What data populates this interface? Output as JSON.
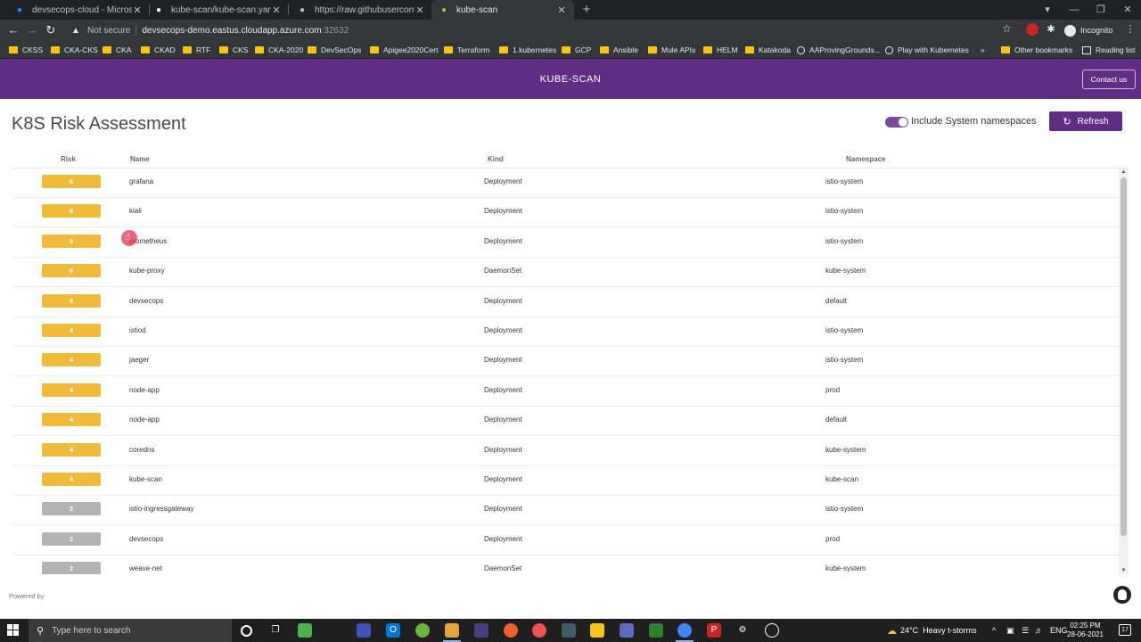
{
  "browser": {
    "tabs": [
      {
        "title": "devsecops-cloud - Microsoft Azu",
        "icon": "azure-icon",
        "color": "#1e90ff",
        "active": false
      },
      {
        "title": "kube-scan/kube-scan.yaml at ma",
        "icon": "github-icon",
        "color": "#ffffff",
        "active": false
      },
      {
        "title": "https://raw.githubusercontent.co",
        "icon": "globe-icon",
        "color": "#bdc1c6",
        "active": false
      },
      {
        "title": "kube-scan",
        "icon": "kube-scan-icon",
        "color": "#8bc34a",
        "active": true
      }
    ],
    "new_tab_glyph": "+",
    "address": {
      "security": "Not secure",
      "host": "devsecops-demo.eastus.cloudapp.azure.com",
      "port": ":32632"
    },
    "profile_label": "Incognito",
    "bookmarks": [
      {
        "label": "CKSS",
        "kind": "folder"
      },
      {
        "label": "CKA-CKS",
        "kind": "folder"
      },
      {
        "label": "CKA",
        "kind": "folder"
      },
      {
        "label": "CKAD",
        "kind": "folder"
      },
      {
        "label": "RTF",
        "kind": "folder"
      },
      {
        "label": "CKS",
        "kind": "folder"
      },
      {
        "label": "CKA-2020",
        "kind": "folder"
      },
      {
        "label": "DevSecOps",
        "kind": "folder"
      },
      {
        "label": "Apigee2020Cert",
        "kind": "folder"
      },
      {
        "label": "Terraform",
        "kind": "folder"
      },
      {
        "label": "1.kubernetes",
        "kind": "folder"
      },
      {
        "label": "GCP",
        "kind": "folder"
      },
      {
        "label": "Ansible",
        "kind": "folder"
      },
      {
        "label": "Mule APIs",
        "kind": "folder"
      },
      {
        "label": "HELM",
        "kind": "folder"
      },
      {
        "label": "Katakoda",
        "kind": "folder"
      },
      {
        "label": "AAProvingGrounds...",
        "kind": "link"
      },
      {
        "label": "Play with Kubernetes",
        "kind": "link"
      }
    ],
    "bookmarks_overflow": "»",
    "other_bookmarks": "Other bookmarks",
    "reading_list": "Reading list"
  },
  "app": {
    "title": "KUBE-SCAN",
    "contact_label": "Contact us",
    "page_title": "K8S Risk Assessment",
    "include_system_label": "Include System namespaces",
    "include_system_on": true,
    "refresh_label": "Refresh",
    "colors": {
      "brand": "#5f2e84",
      "risk_high": "#f0bb3a",
      "risk_low": "#b3b3b3"
    },
    "columns": {
      "risk": "Risk",
      "name": "Name",
      "kind": "Kind",
      "namespace": "Namespace"
    },
    "rows": [
      {
        "risk": "6",
        "level": "high",
        "name": "grafana",
        "kind": "Deployment",
        "namespace": "istio-system"
      },
      {
        "risk": "6",
        "level": "high",
        "name": "kiali",
        "kind": "Deployment",
        "namespace": "istio-system"
      },
      {
        "risk": "6",
        "level": "high",
        "name": "prometheus",
        "kind": "Deployment",
        "namespace": "istio-system"
      },
      {
        "risk": "6",
        "level": "high",
        "name": "kube-proxy",
        "kind": "DaemonSet",
        "namespace": "kube-system"
      },
      {
        "risk": "6",
        "level": "high",
        "name": "devsecops",
        "kind": "Deployment",
        "namespace": "default"
      },
      {
        "risk": "4",
        "level": "high",
        "name": "istiod",
        "kind": "Deployment",
        "namespace": "istio-system"
      },
      {
        "risk": "4",
        "level": "high",
        "name": "jaeger",
        "kind": "Deployment",
        "namespace": "istio-system"
      },
      {
        "risk": "4",
        "level": "high",
        "name": "node-app",
        "kind": "Deployment",
        "namespace": "prod"
      },
      {
        "risk": "4",
        "level": "high",
        "name": "node-app",
        "kind": "Deployment",
        "namespace": "default"
      },
      {
        "risk": "4",
        "level": "high",
        "name": "coredns",
        "kind": "Deployment",
        "namespace": "kube-system"
      },
      {
        "risk": "4",
        "level": "high",
        "name": "kube-scan",
        "kind": "Deployment",
        "namespace": "kube-scan"
      },
      {
        "risk": "3",
        "level": "low",
        "name": "istio-ingressgateway",
        "kind": "Deployment",
        "namespace": "istio-system"
      },
      {
        "risk": "3",
        "level": "low",
        "name": "devsecops",
        "kind": "Deployment",
        "namespace": "prod"
      },
      {
        "risk": "2",
        "level": "low",
        "name": "weave-net",
        "kind": "DaemonSet",
        "namespace": "kube-system"
      }
    ],
    "footer_label": "Powered by"
  },
  "taskbar": {
    "search_placeholder": "Type here to search",
    "weather_temp": "24°C",
    "weather_text": "Heavy t-storms",
    "tray_lang": "ENG",
    "time": "02:25 PM",
    "date": "28-06-2021",
    "notification_count": "17"
  }
}
